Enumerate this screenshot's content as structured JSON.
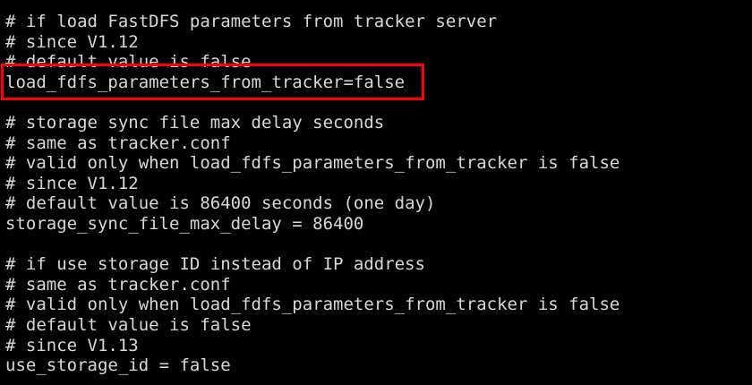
{
  "terminal": {
    "lines": [
      "# if load FastDFS parameters from tracker server",
      "# since V1.12",
      "# default value is false",
      "load_fdfs_parameters_from_tracker=false",
      "",
      "# storage sync file max delay seconds",
      "# same as tracker.conf",
      "# valid only when load_fdfs_parameters_from_tracker is false",
      "# since V1.12",
      "# default value is 86400 seconds (one day)",
      "storage_sync_file_max_delay = 86400",
      "",
      "# if use storage ID instead of IP address",
      "# same as tracker.conf",
      "# valid only when load_fdfs_parameters_from_tracker is false",
      "# default value is false",
      "# since V1.13",
      "use_storage_id = false"
    ]
  },
  "colors": {
    "background": "#000000",
    "text": "#d8d8d8",
    "highlight_border": "#ff0000"
  }
}
